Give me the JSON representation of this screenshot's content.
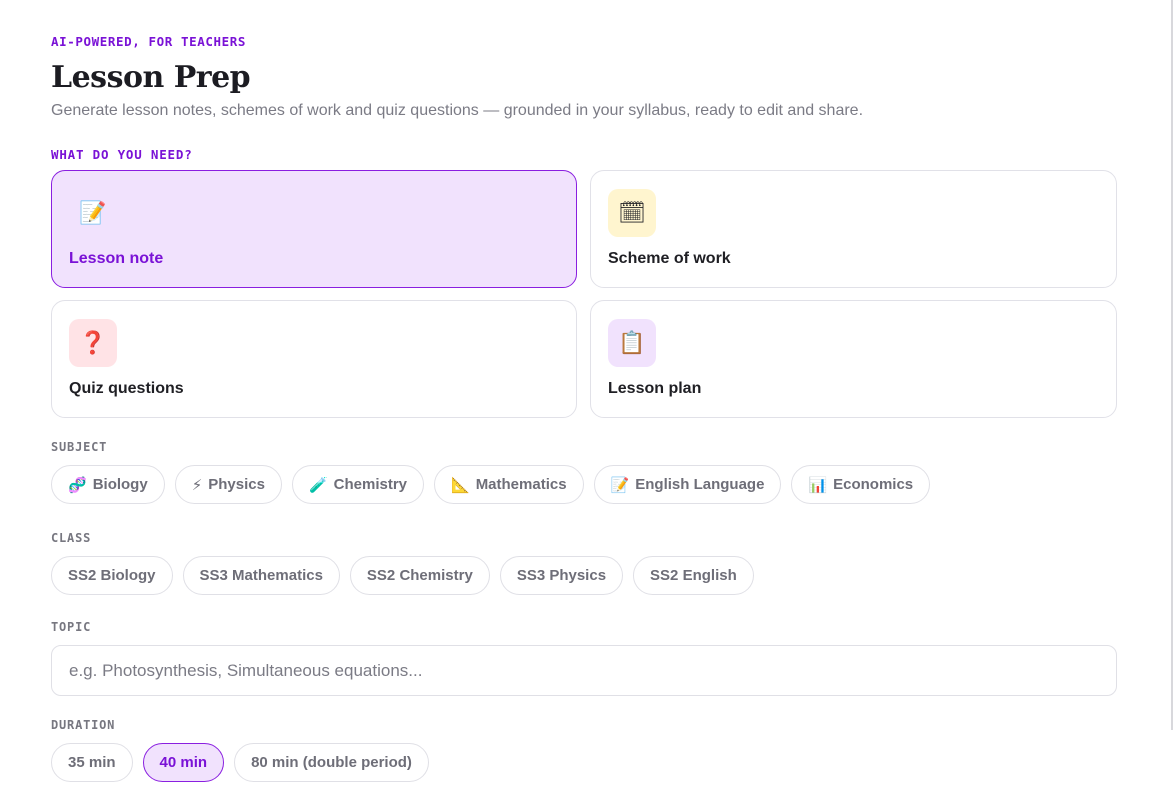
{
  "header": {
    "eyebrow": "AI-POWERED, FOR TEACHERS",
    "title": "Lesson Prep",
    "subtitle": "Generate lesson notes, schemes of work and quiz questions — grounded in your syllabus, ready to edit and share."
  },
  "need": {
    "label": "WHAT DO YOU NEED?",
    "options": [
      {
        "label": "Lesson note",
        "icon": "memo-icon",
        "glyph": "📝",
        "icon_bg": "#f1e2fd",
        "selected": true
      },
      {
        "label": "Scheme of work",
        "icon": "calendar-icon",
        "glyph": "🗓",
        "icon_bg": "#fff5cf",
        "selected": false
      },
      {
        "label": "Quiz questions",
        "icon": "question-mark-icon",
        "glyph": "❓",
        "icon_bg": "#ffe3e6",
        "selected": false
      },
      {
        "label": "Lesson plan",
        "icon": "clipboard-icon",
        "glyph": "📋",
        "icon_bg": "#f1e2fd",
        "selected": false
      }
    ]
  },
  "subject": {
    "label": "SUBJECT",
    "options": [
      {
        "label": "Biology",
        "icon": "dna-icon",
        "glyph": "🧬"
      },
      {
        "label": "Physics",
        "icon": "lightning-icon",
        "glyph": "⚡"
      },
      {
        "label": "Chemistry",
        "icon": "test-tube-icon",
        "glyph": "🧪"
      },
      {
        "label": "Mathematics",
        "icon": "triangle-ruler-icon",
        "glyph": "📐"
      },
      {
        "label": "English Language",
        "icon": "memo-icon",
        "glyph": "📝"
      },
      {
        "label": "Economics",
        "icon": "bar-chart-icon",
        "glyph": "📊"
      }
    ]
  },
  "class": {
    "label": "CLASS",
    "options": [
      "SS2 Biology",
      "SS3 Mathematics",
      "SS2 Chemistry",
      "SS3 Physics",
      "SS2 English"
    ]
  },
  "topic": {
    "label": "TOPIC",
    "value": "",
    "placeholder": "e.g. Photosynthesis, Simultaneous equations..."
  },
  "duration": {
    "label": "DURATION",
    "options": [
      "35 min",
      "40 min",
      "80 min (double period)"
    ],
    "selected": "40 min"
  },
  "colors": {
    "accent": "#7a12d6",
    "accent_bg": "#f1e2fd"
  }
}
